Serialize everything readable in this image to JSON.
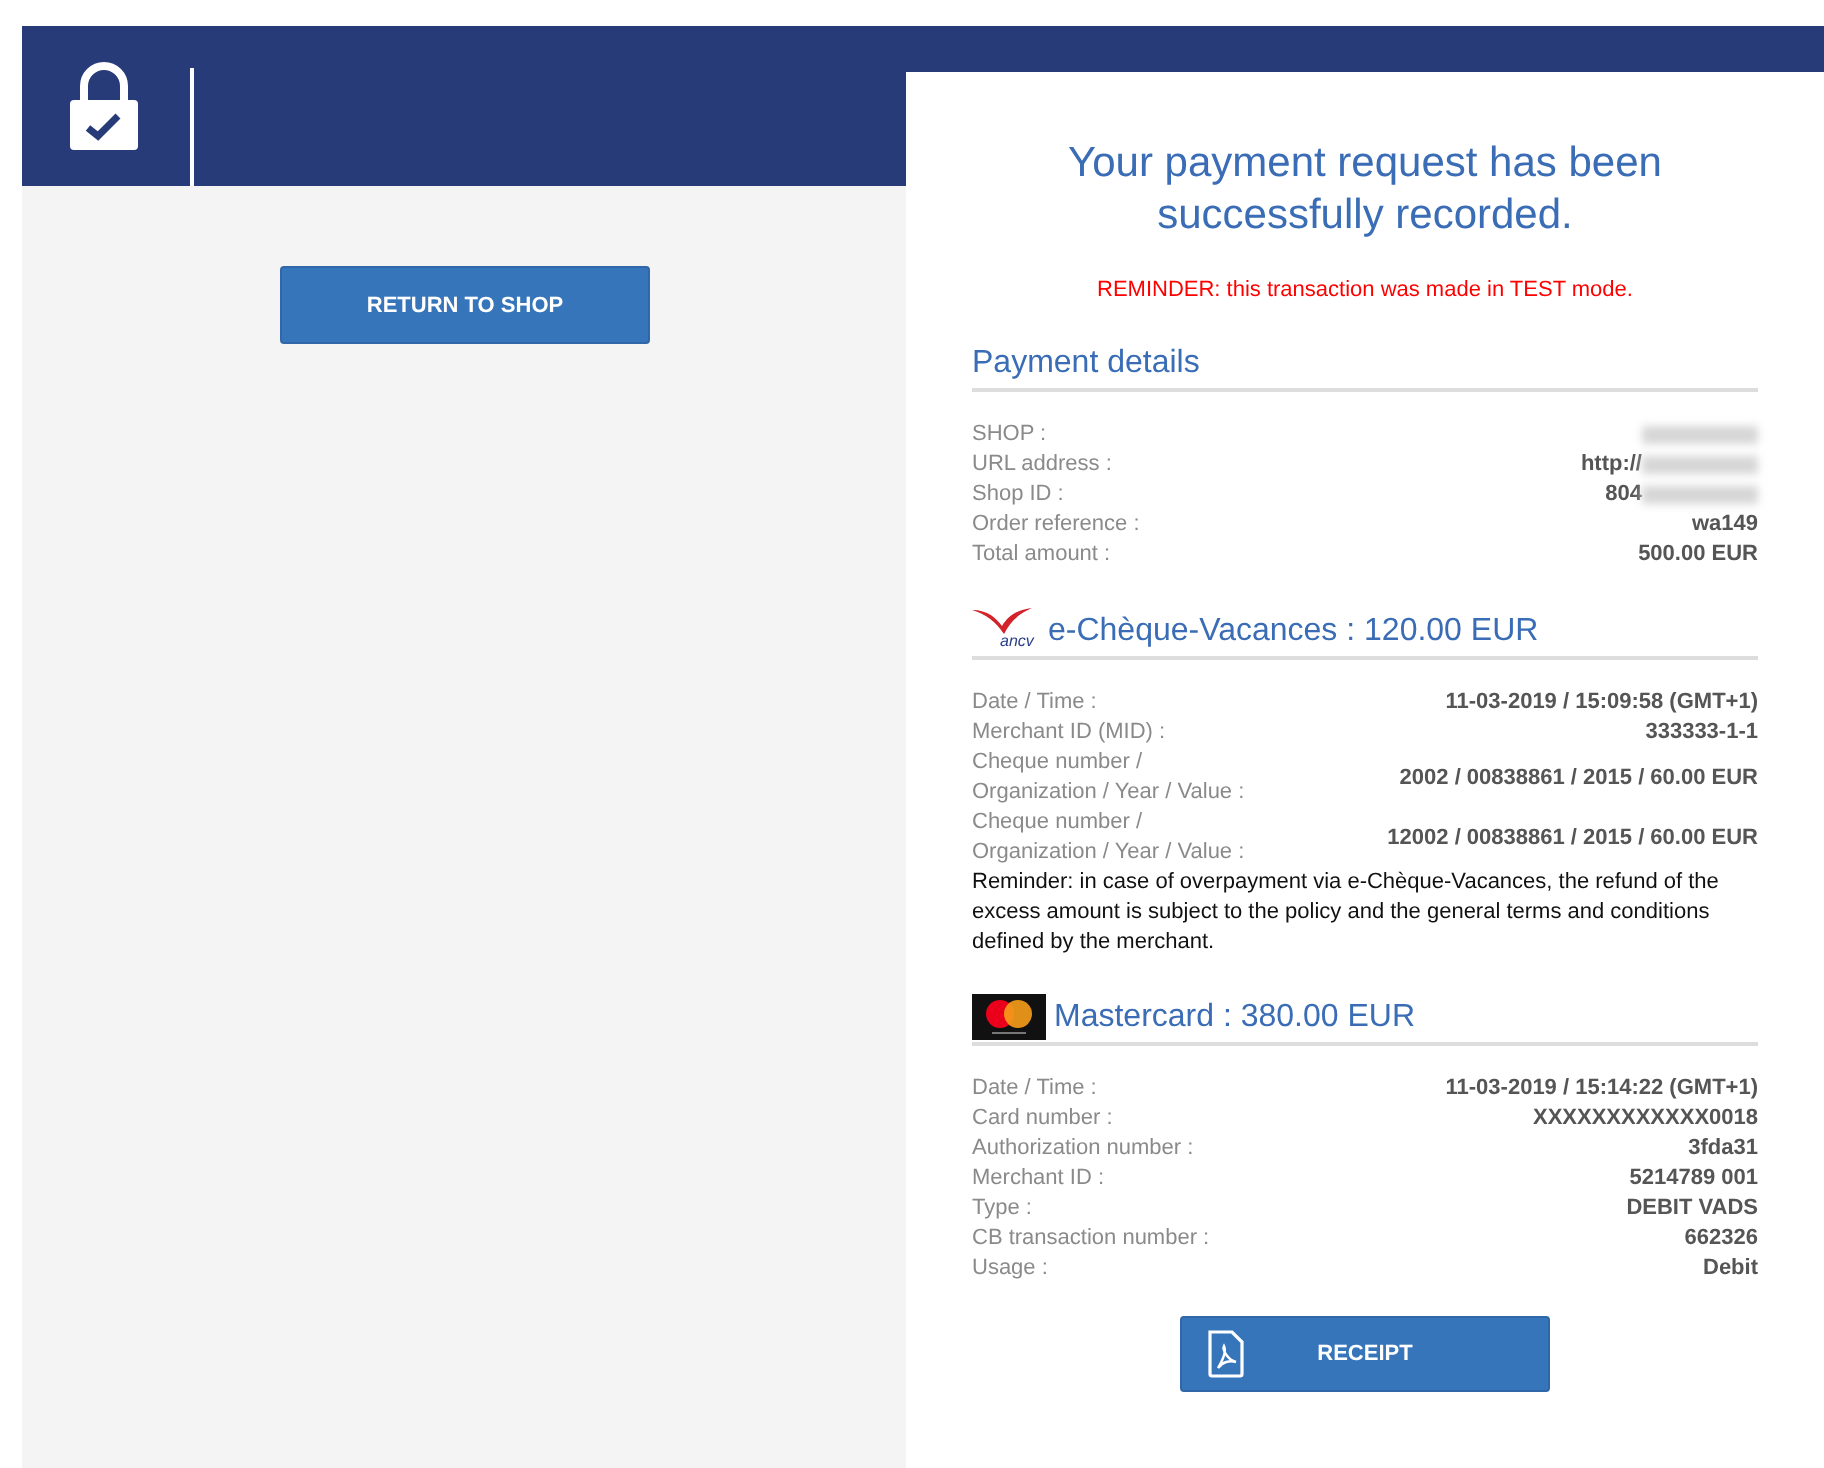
{
  "return_button": "RETURN TO SHOP",
  "title": "Your payment request has been successfully recorded.",
  "test_reminder": "REMINDER: this transaction was made in TEST mode.",
  "sections": [
    {
      "kind": "details",
      "heading": "Payment details",
      "rows": [
        {
          "label": "SHOP :",
          "redacted": true
        },
        {
          "label": "URL address :",
          "value": "http://",
          "redacted": true
        },
        {
          "label": "Shop ID :",
          "value": "804",
          "redacted": true
        },
        {
          "label": "Order reference :",
          "value": "wa149"
        },
        {
          "label": "Total amount :",
          "value": "500.00 EUR"
        }
      ]
    },
    {
      "kind": "ancv",
      "heading": "e-Chèque-Vacances : 120.00 EUR",
      "logo_text": "ancv",
      "rows": [
        {
          "label": "Date / Time :",
          "value": "11-03-2019 / 15:09:58 (GMT+1)"
        },
        {
          "label": "Merchant ID (MID) :",
          "value": "333333-1-1"
        },
        {
          "label": "Cheque number / Organization / Year / Value :",
          "value": "2002 / 00838861 / 2015 / 60.00 EUR"
        },
        {
          "label": "Cheque number / Organization / Year / Value :",
          "value": "12002 / 00838861 / 2015 / 60.00 EUR"
        }
      ],
      "note": "Reminder: in case of overpayment via e-Chèque-Vacances, the refund of the excess amount is subject to the policy and the general terms and conditions defined by the merchant."
    },
    {
      "kind": "mastercard",
      "heading": "Mastercard : 380.00 EUR",
      "rows": [
        {
          "label": "Date / Time :",
          "value": "11-03-2019 / 15:14:22 (GMT+1)"
        },
        {
          "label": "Card number :",
          "value": "XXXXXXXXXXXX0018"
        },
        {
          "label": "Authorization number :",
          "value": "3fda31"
        },
        {
          "label": "Merchant ID :",
          "value": "5214789 001"
        },
        {
          "label": "Type :",
          "value": "DEBIT VADS"
        },
        {
          "label": "CB transaction number :",
          "value": "662326"
        },
        {
          "label": "Usage :",
          "value": "Debit"
        }
      ]
    }
  ],
  "receipt_button": "RECEIPT"
}
